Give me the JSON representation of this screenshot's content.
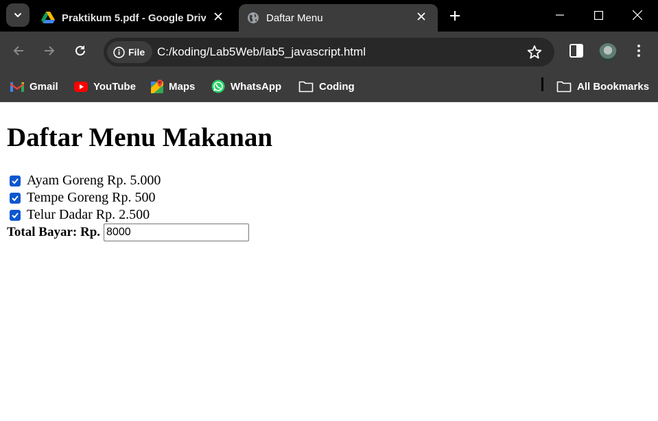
{
  "tabs": [
    {
      "title": "Praktikum 5.pdf - Google Drive",
      "icon": "google-drive-icon",
      "active": false
    },
    {
      "title": "Daftar Menu",
      "icon": "globe-icon",
      "active": true
    }
  ],
  "toolbar": {
    "site_chip_label": "File",
    "url": "C:/koding/Lab5Web/lab5_javascript.html"
  },
  "bookmarks": {
    "items": [
      {
        "label": "Gmail",
        "icon": "gmail-icon"
      },
      {
        "label": "YouTube",
        "icon": "youtube-icon"
      },
      {
        "label": "Maps",
        "icon": "maps-icon"
      },
      {
        "label": "WhatsApp",
        "icon": "whatsapp-icon"
      },
      {
        "label": "Coding",
        "icon": "folder-icon"
      }
    ],
    "all_label": "All Bookmarks"
  },
  "page": {
    "title": "Daftar Menu Makanan",
    "items": [
      {
        "label": "Ayam Goreng Rp. 5.000",
        "checked": true
      },
      {
        "label": "Tempe Goreng Rp. 500",
        "checked": true
      },
      {
        "label": "Telur Dadar Rp. 2.500",
        "checked": true
      }
    ],
    "total_label": "Total Bayar: Rp.",
    "total_value": "8000"
  },
  "colors": {
    "titlebar": "#000000",
    "toolbar": "#3c3c3c",
    "omnibox": "#282828",
    "checkbox": "#0b57d0"
  }
}
